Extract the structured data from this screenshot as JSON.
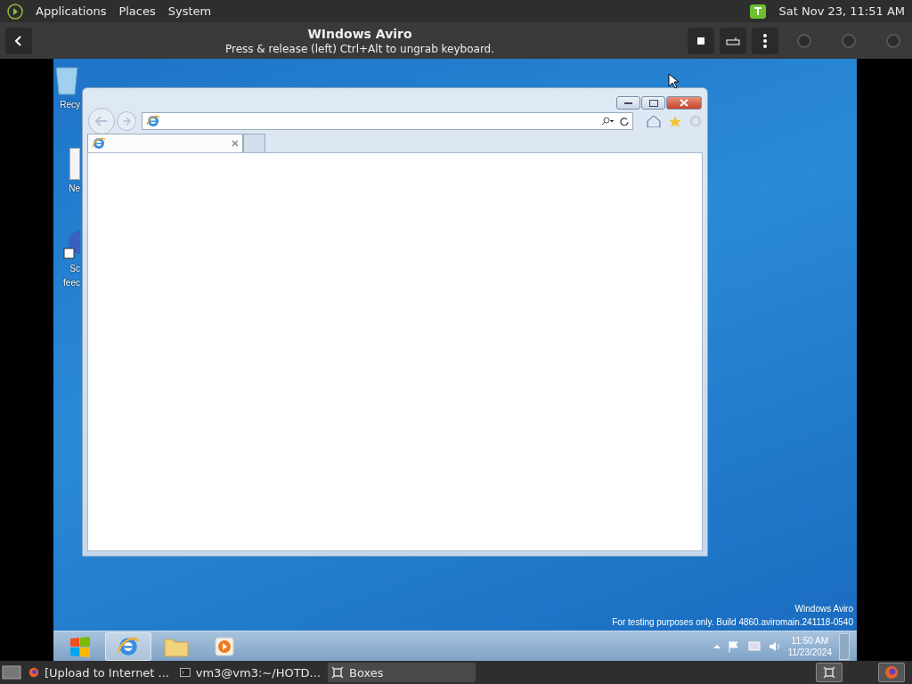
{
  "top_panel": {
    "menus": [
      "Applications",
      "Places",
      "System"
    ],
    "clock": "Sat Nov 23, 11:51 AM"
  },
  "boxes_header": {
    "title": "WIndows Aviro",
    "subtitle": "Press & release (left) Ctrl+Alt to ungrab keyboard."
  },
  "desktop": {
    "icons": [
      {
        "kind": "recycle",
        "lines": [
          "Recy"
        ]
      },
      {
        "kind": "notepad",
        "lines": [
          "Ne"
        ]
      },
      {
        "kind": "shortcut",
        "lines": [
          "Sc",
          "feec"
        ]
      }
    ]
  },
  "browser": {
    "tabs": [
      {
        "selected": true
      }
    ]
  },
  "desktop_text": {
    "edition": "Windows Aviro",
    "build": "For testing purposes only. Build 4860.aviromain.241118-0540"
  },
  "win_taskbar": {
    "items": [
      {
        "kind": "start",
        "selected": false
      },
      {
        "kind": "ie",
        "selected": true
      },
      {
        "kind": "folder",
        "selected": false
      },
      {
        "kind": "media",
        "selected": false
      }
    ],
    "time": "11:50 AM",
    "date": "11/23/2024"
  },
  "bottom_panel": {
    "tasks": [
      {
        "kind": "firefox",
        "label": "[Upload to Internet ...",
        "selected": false
      },
      {
        "kind": "terminal",
        "label": "vm3@vm3:~/HOTD...",
        "selected": false
      },
      {
        "kind": "boxes",
        "label": "Boxes",
        "selected": true
      }
    ]
  }
}
